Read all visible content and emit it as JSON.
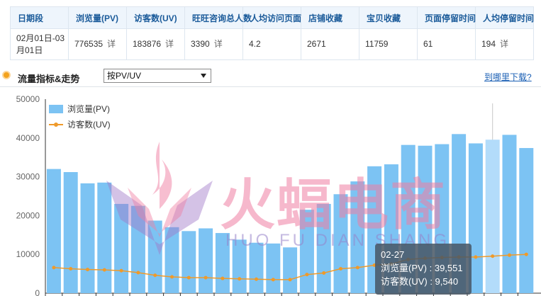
{
  "summary": {
    "headers": [
      "日期段",
      "浏览量(PV)",
      "访客数(UV)",
      "旺旺咨询总人数",
      "人均访问页面",
      "店铺收藏",
      "宝贝收藏",
      "页面停留时间",
      "人均停留时间"
    ],
    "date_range": "02月01日-03月01日",
    "pv": "776535",
    "uv": "183876",
    "wangwang": "3390",
    "avg_pages": "4.2",
    "shop_fav": "2671",
    "item_fav": "11759",
    "page_stay": "61",
    "avg_stay": "194",
    "detail_label": "详"
  },
  "section": {
    "title": "流量指标&走势",
    "select_value": "按PV/UV",
    "download_link": "到哪里下载?"
  },
  "watermark": {
    "text": "火蝠电商",
    "sub": "HUO FU DIAN SHANG"
  },
  "tooltip": {
    "date": "02-27",
    "pv_line": "浏览量(PV) : 39,551",
    "uv_line": "访客数(UV) : 9,540"
  },
  "chart_data": {
    "type": "bar",
    "y_ticks": [
      "50000",
      "40000",
      "30000",
      "20000",
      "10000",
      "0"
    ],
    "ylim": [
      0,
      50000
    ],
    "grid": false,
    "legend_position": "top-left",
    "colors": {
      "pv": "#7cc3f3",
      "pv_highlight": "#b3dcfa",
      "uv": "#ef9a2a"
    },
    "highlight_index": 26,
    "series": [
      {
        "name": "浏览量(PV)",
        "type": "bar",
        "values": [
          32000,
          31200,
          28300,
          28500,
          23000,
          22500,
          18700,
          17000,
          16000,
          16700,
          15500,
          13800,
          13000,
          12800,
          11800,
          21500,
          23000,
          25500,
          28800,
          32700,
          33200,
          38200,
          38000,
          38400,
          41000,
          38600,
          39551,
          40800,
          37400
        ]
      },
      {
        "name": "访客数(UV)",
        "type": "line",
        "values": [
          6600,
          6300,
          6100,
          6000,
          5800,
          5300,
          4600,
          4200,
          4000,
          4000,
          3800,
          3700,
          3600,
          3500,
          3500,
          4800,
          5200,
          6300,
          6600,
          7200,
          7500,
          8700,
          9000,
          9200,
          9300,
          9300,
          9540,
          9800,
          10000
        ]
      }
    ]
  }
}
